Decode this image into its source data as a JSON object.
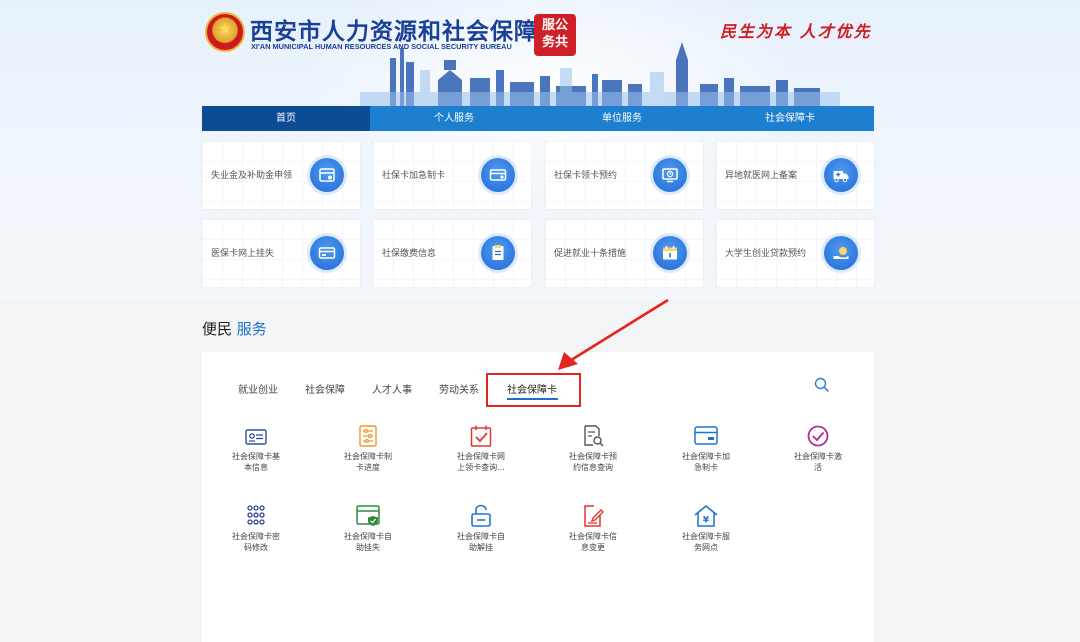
{
  "header": {
    "title": "西安市人力资源和社会保障局",
    "subtitle": "XI'AN MUNICIPAL HUMAN RESOURCES AND SOCIAL SECURITY BUREAU",
    "seal_line1": "服公",
    "seal_line2": "务共",
    "slogan": "民生为本 人才优先"
  },
  "nav": {
    "items": [
      {
        "label": "首页",
        "active": true
      },
      {
        "label": "个人服务"
      },
      {
        "label": "单位服务"
      },
      {
        "label": "社会保障卡"
      }
    ]
  },
  "quick_cards": [
    {
      "label": "失业金及补助金申领",
      "icon": "calendar-money-icon"
    },
    {
      "label": "社保卡加急制卡",
      "icon": "card-icon"
    },
    {
      "label": "社保卡领卡预约",
      "icon": "clock-monitor-icon"
    },
    {
      "label": "异地就医网上备案",
      "icon": "ambulance-icon"
    },
    {
      "label": "医保卡网上挂失",
      "icon": "card-icon"
    },
    {
      "label": "社保缴费信息",
      "icon": "document-icon"
    },
    {
      "label": "促进就业十条措施",
      "icon": "calendar-icon"
    },
    {
      "label": "大学生创业贷款预约",
      "icon": "money-hand-icon"
    }
  ],
  "section": {
    "title_plain": "便民",
    "title_highlight": "服务"
  },
  "tabs": [
    {
      "label": "就业创业"
    },
    {
      "label": "社会保障"
    },
    {
      "label": "人才人事"
    },
    {
      "label": "劳动关系"
    },
    {
      "label": "社会保障卡",
      "active": true
    }
  ],
  "services": [
    {
      "line1": "社会保障卡基",
      "line2": "本信息",
      "icon": "id-card-icon",
      "color": "#2c4ea8"
    },
    {
      "line1": "社会保障卡制",
      "line2": "卡进度",
      "icon": "progress-list-icon",
      "color": "#f0962a"
    },
    {
      "line1": "社会保障卡网",
      "line2": "上领卡查询...",
      "icon": "calendar-check-icon",
      "color": "#e0382f"
    },
    {
      "line1": "社会保障卡预",
      "line2": "约信息查询",
      "icon": "document-search-icon",
      "color": "#555555"
    },
    {
      "line1": "社会保障卡加",
      "line2": "急制卡",
      "icon": "card-icon",
      "color": "#1e74d2"
    },
    {
      "line1": "社会保障卡激",
      "line2": "活",
      "icon": "check-circle-icon",
      "color": "#b22c96"
    },
    {
      "line1": "社会保障卡密",
      "line2": "码修改",
      "icon": "keypad-icon",
      "color": "#2c3f9a"
    },
    {
      "line1": "社会保障卡自",
      "line2": "助挂失",
      "icon": "window-shield-icon",
      "color": "#2f8a3b"
    },
    {
      "line1": "社会保障卡自",
      "line2": "助解挂",
      "icon": "unlock-icon",
      "color": "#1e74d2"
    },
    {
      "line1": "社会保障卡信",
      "line2": "息变更",
      "icon": "edit-document-icon",
      "color": "#e0382f"
    },
    {
      "line1": "社会保障卡服",
      "line2": "务网点",
      "icon": "house-yuan-icon",
      "color": "#1e74d2"
    }
  ]
}
